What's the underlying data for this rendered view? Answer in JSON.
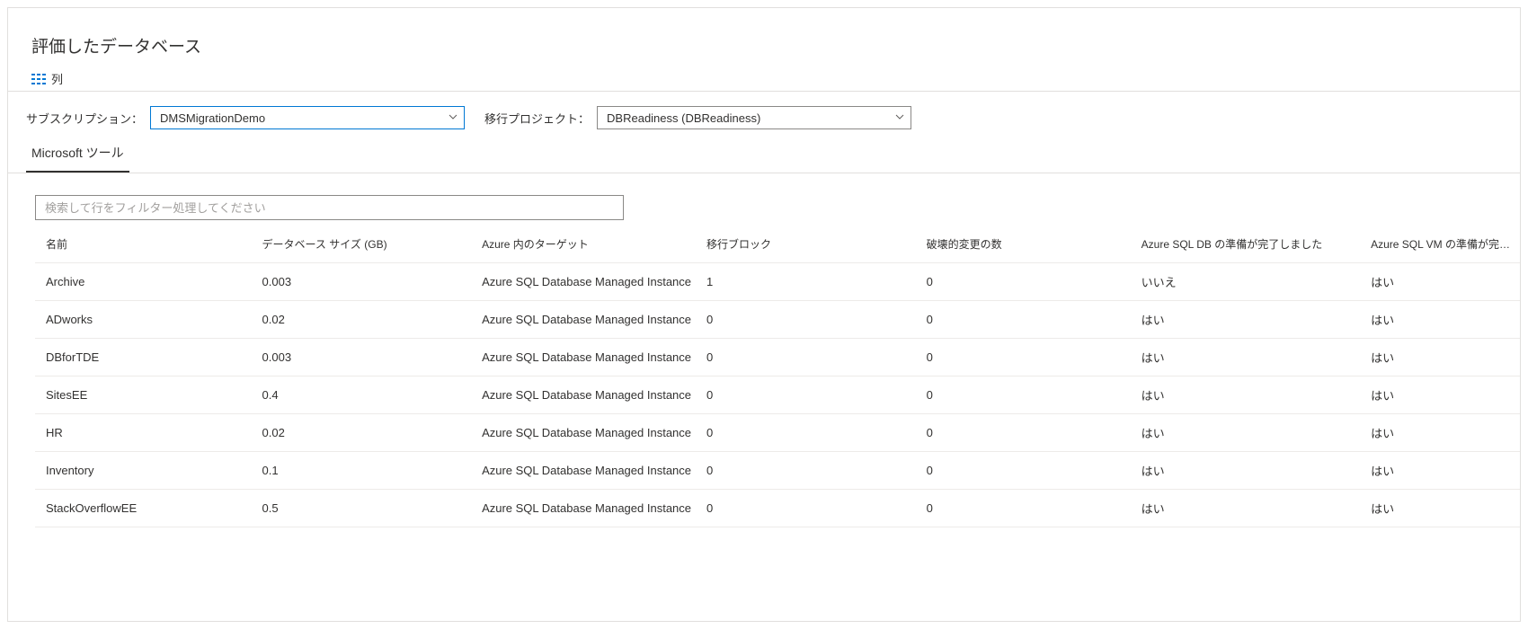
{
  "page": {
    "title": "評価したデータベース"
  },
  "toolbar": {
    "columns_label": "列"
  },
  "filters": {
    "subscription_label": "サブスクリプション：",
    "subscription_value": "DMSMigrationDemo",
    "project_label": "移行プロジェクト：",
    "project_value": "DBReadiness (DBReadiness)"
  },
  "tabs": {
    "microsoft_tools": "Microsoft ツール"
  },
  "search": {
    "placeholder": "検索して行をフィルター処理してください"
  },
  "table": {
    "headers": {
      "name": "名前",
      "size": "データベース サイズ (GB)",
      "target": "Azure 内のターゲット",
      "block": "移行ブロック",
      "breaking": "破壊的変更の数",
      "db_ready": "Azure SQL DB の準備が完了しました",
      "vm_ready": "Azure SQL VM の準備が完了しました"
    },
    "rows": [
      {
        "name": "Archive",
        "size": "0.003",
        "target": "Azure SQL Database Managed Instance",
        "block": "1",
        "breaking": "0",
        "db_ready": "いいえ",
        "vm_ready": "はい"
      },
      {
        "name": "ADworks",
        "size": "0.02",
        "target": "Azure SQL Database Managed Instance",
        "block": "0",
        "breaking": "0",
        "db_ready": "はい",
        "vm_ready": "はい"
      },
      {
        "name": "DBforTDE",
        "size": "0.003",
        "target": "Azure SQL Database Managed Instance",
        "block": "0",
        "breaking": "0",
        "db_ready": "はい",
        "vm_ready": "はい"
      },
      {
        "name": "SitesEE",
        "size": "0.4",
        "target": "Azure SQL Database Managed Instance",
        "block": "0",
        "breaking": "0",
        "db_ready": "はい",
        "vm_ready": "はい"
      },
      {
        "name": "HR",
        "size": "0.02",
        "target": "Azure SQL Database Managed Instance",
        "block": "0",
        "breaking": "0",
        "db_ready": "はい",
        "vm_ready": "はい"
      },
      {
        "name": "Inventory",
        "size": "0.1",
        "target": "Azure SQL Database Managed Instance",
        "block": "0",
        "breaking": "0",
        "db_ready": "はい",
        "vm_ready": "はい"
      },
      {
        "name": "StackOverflowEE",
        "size": "0.5",
        "target": "Azure SQL Database Managed Instance",
        "block": "0",
        "breaking": "0",
        "db_ready": "はい",
        "vm_ready": "はい"
      }
    ]
  }
}
